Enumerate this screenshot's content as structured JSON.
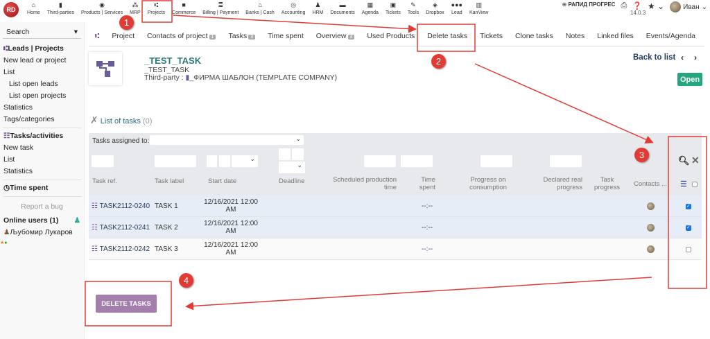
{
  "topbar": {
    "logo": "RD",
    "menu": [
      {
        "label": "Home",
        "icon": "⌂"
      },
      {
        "label": "Third-parties",
        "icon": "▮"
      },
      {
        "label": "Products | Services",
        "icon": "◉"
      },
      {
        "label": "MRP",
        "icon": "⁂"
      },
      {
        "label": "Projects",
        "icon": "⑆"
      },
      {
        "label": "Commerce",
        "icon": "■"
      },
      {
        "label": "Billing | Payment",
        "icon": "≣"
      },
      {
        "label": "Banks | Cash",
        "icon": "⌂"
      },
      {
        "label": "Accounting",
        "icon": "◎"
      },
      {
        "label": "HRM",
        "icon": "♟"
      },
      {
        "label": "Documents",
        "icon": "▬"
      },
      {
        "label": "Agenda",
        "icon": "▦"
      },
      {
        "label": "Tickets",
        "icon": "▣"
      },
      {
        "label": "Tools",
        "icon": "✎"
      },
      {
        "label": "Dropbox",
        "icon": "◈"
      },
      {
        "label": "Lead",
        "icon": "●●●"
      },
      {
        "label": "KanView",
        "icon": "▥"
      }
    ],
    "company": "РАПИД ПРОГРЕС",
    "version": "14.0.3",
    "user": "Иван"
  },
  "sidebar": {
    "search_placeholder": "Search",
    "leads_title": "Leads | Projects",
    "leads_items": [
      "New lead or project",
      "List",
      "List open leads",
      "List open projects",
      "Statistics",
      "Tags/categories"
    ],
    "tasks_title": "Tasks/activities",
    "tasks_items": [
      "New task",
      "List",
      "Statistics"
    ],
    "time_spent": "Time spent",
    "report_bug": "Report a bug",
    "online_users": "Online users (1)",
    "online_user": "Љубомир Лукаров"
  },
  "tabs": [
    {
      "label": "Project"
    },
    {
      "label": "Contacts of project",
      "badge": "1"
    },
    {
      "label": "Tasks",
      "badge": "3"
    },
    {
      "label": "Time spent"
    },
    {
      "label": "Overview",
      "badge": "3"
    },
    {
      "label": "Used Products"
    },
    {
      "label": "Delete tasks"
    },
    {
      "label": "Tickets"
    },
    {
      "label": "Clone tasks"
    },
    {
      "label": "Notes"
    },
    {
      "label": "Linked files"
    },
    {
      "label": "Events/Agenda"
    }
  ],
  "project": {
    "ref": "_TEST_TASK",
    "label": "_TEST_TASK",
    "thirdparty_label": "Third-party :",
    "thirdparty": "_ФИРМА ШАБЛОН (TEMPLATE COMPANY)",
    "back": "Back to list",
    "status": "Open"
  },
  "list": {
    "title": "List of tasks",
    "count": "(0)",
    "assigned_label": "Tasks assigned to:",
    "columns": [
      "Task ref.",
      "Task label",
      "Start date",
      "Deadline",
      "Scheduled production time",
      "Time spent",
      "Progress on consumption",
      "Declared real progress",
      "Task progress",
      "Contacts ..."
    ],
    "rows": [
      {
        "ref": "TASK2112-0240",
        "label": "TASK 1",
        "start": "12/16/2021 12:00 AM",
        "time": "--:--",
        "checked": true
      },
      {
        "ref": "TASK2112-0241",
        "label": "TASK 2",
        "start": "12/16/2021 12:00 AM",
        "time": "--:--",
        "checked": true
      },
      {
        "ref": "TASK2112-0242",
        "label": "TASK 3",
        "start": "12/16/2021 12:00 AM",
        "time": "--:--",
        "checked": false
      }
    ]
  },
  "delete_button": "DELETE TASKS",
  "annotations": [
    "1",
    "2",
    "3",
    "4"
  ],
  "colors": {
    "accent": "#2b7a78",
    "delete": "#a47fae",
    "open": "#25a580",
    "annotation": "#e23b33"
  }
}
